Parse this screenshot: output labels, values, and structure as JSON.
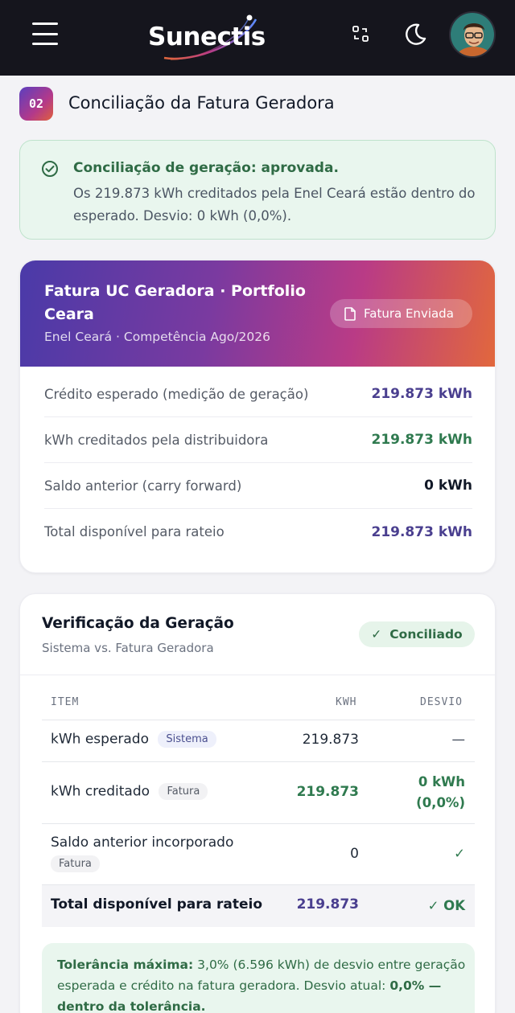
{
  "app": {
    "logo_text": "Sunectis"
  },
  "page": {
    "step": "02",
    "title": "Conciliação da Fatura Geradora"
  },
  "alert": {
    "title": "Conciliação de geração: aprovada.",
    "body": "Os 219.873 kWh creditados pela Enel Ceará estão dentro do esperado. Desvio: 0 kWh (0,0%)."
  },
  "invoice": {
    "title": "Fatura UC Geradora · Portfolio Ceara",
    "subtitle": "Enel Ceará · Competência Ago/2026",
    "status_label": "Fatura Enviada",
    "rows": [
      {
        "label": "Crédito esperado (medição de geração)",
        "value": "219.873 kWh"
      },
      {
        "label": "kWh creditados pela distribuidora",
        "value": "219.873 kWh"
      },
      {
        "label": "Saldo anterior (carry forward)",
        "value": "0 kWh"
      },
      {
        "label": "Total disponível para rateio",
        "value": "219.873 kWh"
      }
    ]
  },
  "verification": {
    "title": "Verificação da Geração",
    "subtitle": "Sistema vs. Fatura Geradora",
    "status": "Conciliado",
    "columns": {
      "item": "ITEM",
      "kwh": "KWH",
      "dev": "DESVIO"
    },
    "rows": [
      {
        "item": "kWh esperado",
        "tag": "Sistema",
        "kwh": "219.873",
        "dev": "—"
      },
      {
        "item": "kWh creditado",
        "tag": "Fatura",
        "kwh": "219.873",
        "dev_line1": "0 kWh",
        "dev_line2": "(0,0%)"
      },
      {
        "item": "Saldo anterior incorporado",
        "tag": "Fatura",
        "kwh": "0",
        "dev": "✓"
      }
    ],
    "total": {
      "item": "Total disponível para rateio",
      "kwh": "219.873",
      "dev": "✓ OK"
    },
    "note": {
      "label": "Tolerância máxima:",
      "text": "3,0% (6.596 kWh) de desvio entre geração esperada e crédito na fatura geradora. Desvio atual:",
      "current": "0,0% — dentro da tolerância."
    }
  },
  "colors": {
    "topbar": "#15151d",
    "accent_purple": "#4a3f8f",
    "success_green": "#2f7a4f"
  },
  "icons": [
    "menu-icon",
    "swap-icon",
    "moon-icon",
    "check-circle-icon",
    "document-icon",
    "check-icon"
  ]
}
